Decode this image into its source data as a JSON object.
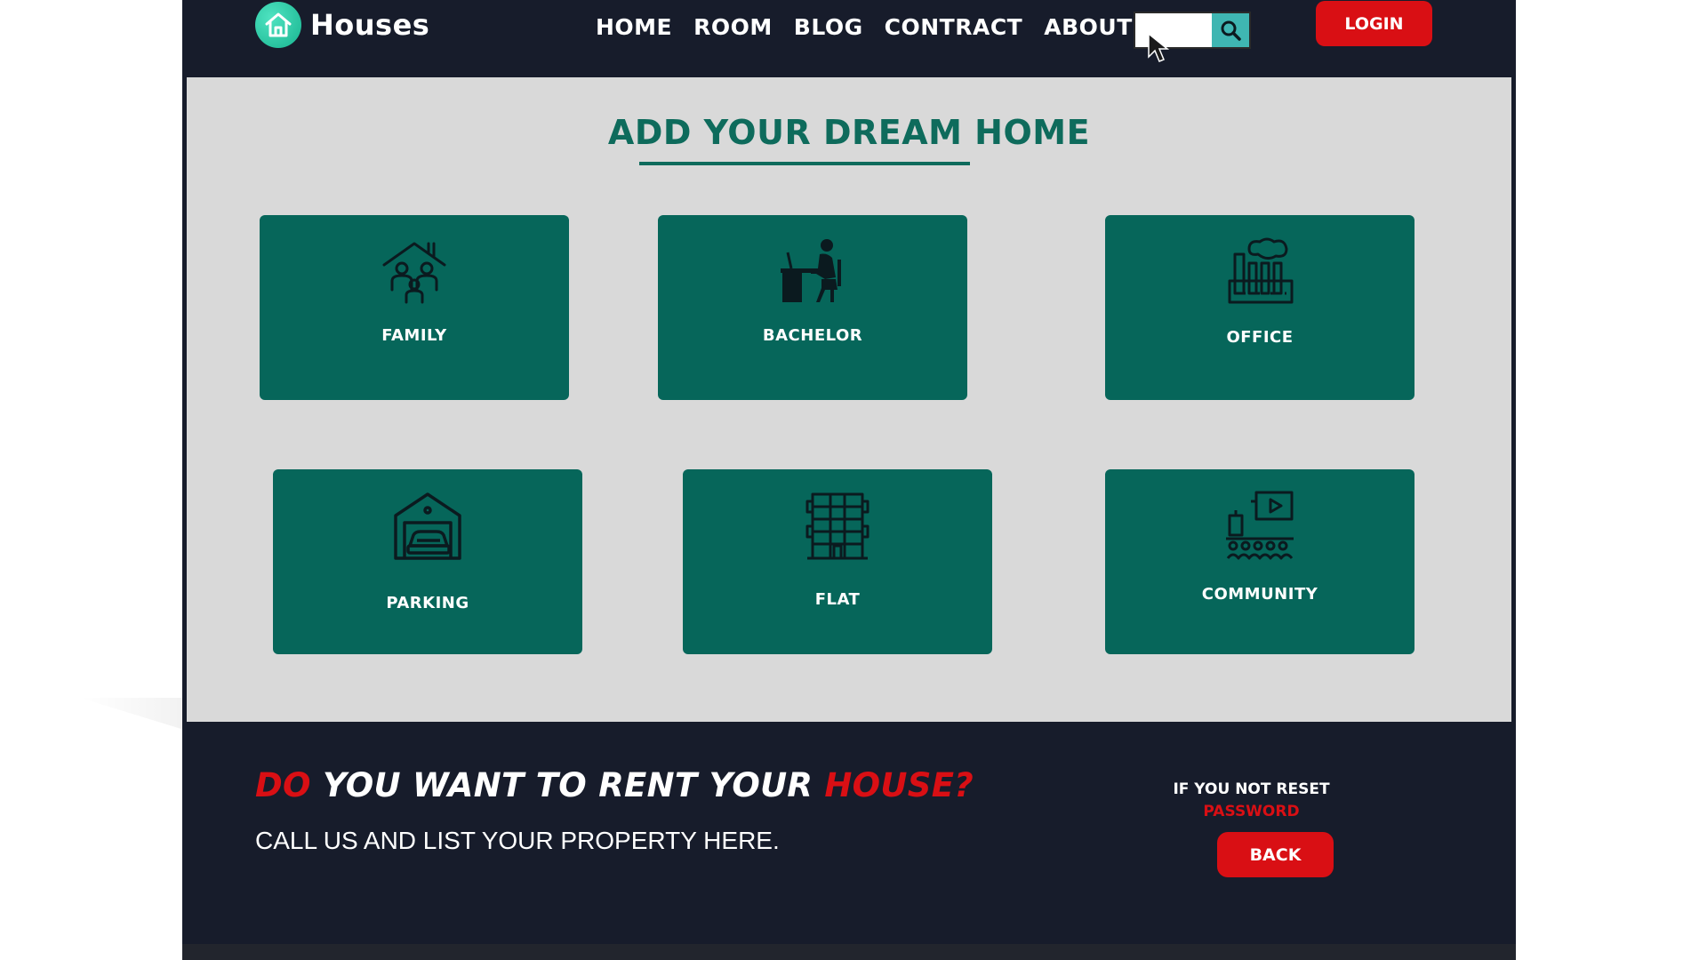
{
  "header": {
    "brand": "Houses",
    "nav": [
      "HOME",
      "ROOM",
      "BLOG",
      "CONTRACT",
      "ABOUT"
    ],
    "search": {
      "value": "",
      "placeholder": ""
    },
    "login_label": "LOGIN"
  },
  "main": {
    "title": "ADD YOUR DREAM HOME",
    "cards": [
      {
        "label": "FAMILY",
        "icon": "family-house-icon"
      },
      {
        "label": "BACHELOR",
        "icon": "person-desk-icon"
      },
      {
        "label": "OFFICE",
        "icon": "factory-icon"
      },
      {
        "label": "PARKING",
        "icon": "garage-car-icon"
      },
      {
        "label": "FLAT",
        "icon": "apartment-building-icon"
      },
      {
        "label": "COMMUNITY",
        "icon": "community-screen-icon"
      }
    ]
  },
  "footer": {
    "heading_part1": "DO",
    "heading_part2": " YOU WANT TO RENT YOUR ",
    "heading_part3": "HOUSE?",
    "subheading": "CALL US AND LIST YOUR PROPERTY HERE.",
    "reset_text": "IF YOU NOT RESET",
    "reset_link": "PASSWORD",
    "back_label": "BACK"
  },
  "colors": {
    "navy": "#171c2b",
    "teal_card": "#06665a",
    "teal_text": "#0e6b5c",
    "red": "#d90f14",
    "panel_gray": "#d9d9d9",
    "logo_teal": "#1fc39b",
    "search_teal": "#3fb6b2"
  }
}
